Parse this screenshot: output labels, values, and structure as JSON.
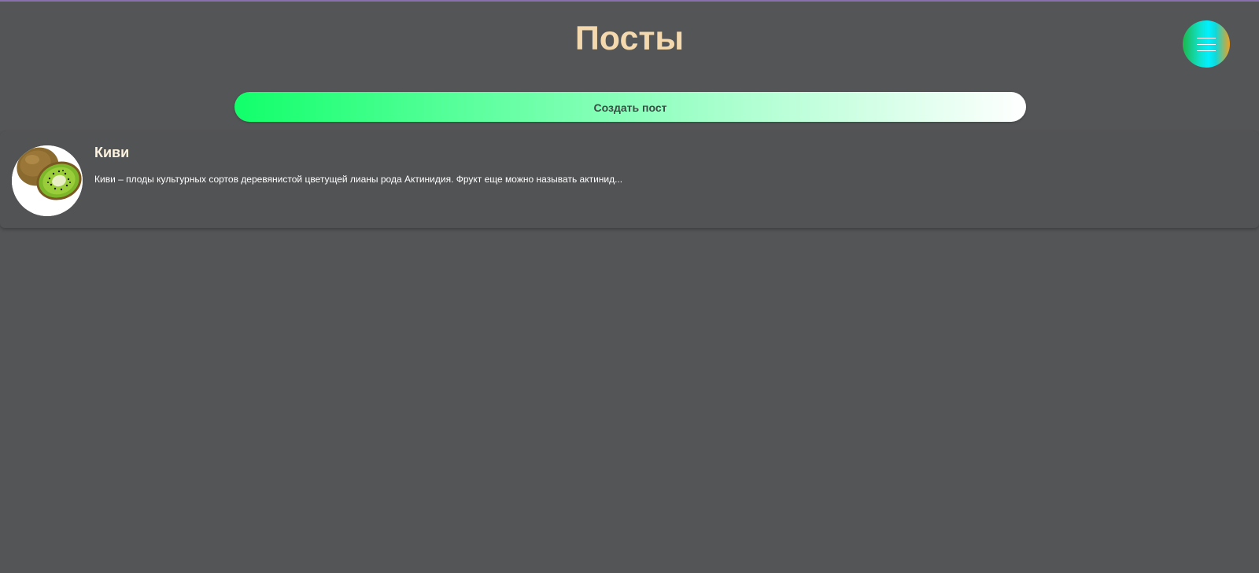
{
  "header": {
    "title": "Посты",
    "menu_icon": "hamburger-icon"
  },
  "actions": {
    "create_post_label": "Создать пост"
  },
  "posts": [
    {
      "title": "Киви",
      "excerpt": "Киви – плоды культурных сортов деревянистой цветущей лианы рода Актинидия. Фрукт еще можно называть актинид...",
      "image_icon": "kiwi-fruit-image"
    }
  ],
  "colors": {
    "background": "#545557",
    "title": "#f5d9ae",
    "accent_green": "#11ff6a"
  }
}
